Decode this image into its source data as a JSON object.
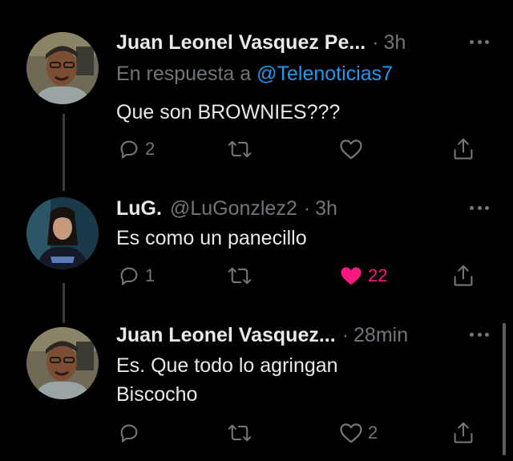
{
  "colors": {
    "background": "#000000",
    "text_primary": "#e7e9ea",
    "text_secondary": "#71767b",
    "link": "#1d9bf0",
    "like": "#f91880",
    "thread_line": "#3a3d41"
  },
  "tweets": [
    {
      "name": "Juan Leonel Vasquez Pe...",
      "handle": "",
      "time": "3h",
      "reply_prefix": "En respuesta a ",
      "reply_mention": "@Telenoticias7",
      "lines": [
        "Que son BROWNIES???"
      ],
      "replies": "2",
      "retweets": "",
      "likes": "",
      "liked": false,
      "icons": [
        "reply-icon",
        "retweet-icon",
        "like-icon",
        "share-icon",
        "more-icon"
      ]
    },
    {
      "name": "LuG.",
      "handle": "@LuGonzlez2",
      "time": "3h",
      "lines": [
        "Es como un panecillo"
      ],
      "replies": "1",
      "retweets": "",
      "likes": "22",
      "liked": true,
      "icons": [
        "reply-icon",
        "retweet-icon",
        "heart-filled-icon",
        "share-icon",
        "more-icon"
      ]
    },
    {
      "name": "Juan Leonel Vasquez...",
      "handle": "",
      "time": "28min",
      "lines": [
        "Es. Que todo lo agringan",
        "Biscocho"
      ],
      "replies": "",
      "retweets": "",
      "likes": "2",
      "liked": false,
      "icons": [
        "reply-icon",
        "retweet-icon",
        "like-icon",
        "share-icon",
        "more-icon"
      ]
    }
  ]
}
